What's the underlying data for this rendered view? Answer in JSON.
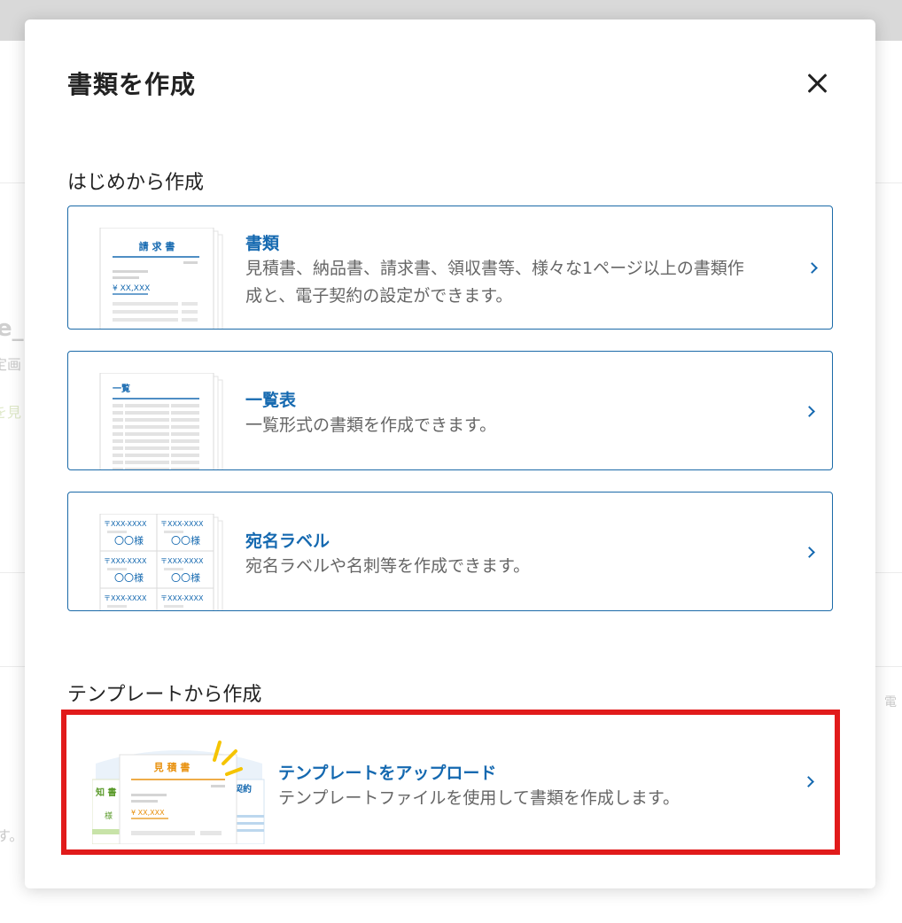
{
  "background": {
    "fragments": [
      "e_",
      "定画",
      "を見",
      "電",
      "す。"
    ]
  },
  "modal": {
    "title": "書類を作成",
    "close_label": "×",
    "section_scratch": "はじめから作成",
    "section_template": "テンプレートから作成"
  },
  "cards": [
    {
      "title": "書類",
      "description_line1": "見積書、納品書、請求書、領収書等、様々な1ページ以上の書類作",
      "description_line2": "成と、電子契約の設定ができます。",
      "thumb": {
        "heading": "請 求 書",
        "amount": "¥ XX,XXX"
      }
    },
    {
      "title": "一覧表",
      "description_line1": "一覧形式の書類を作成できます。",
      "thumb": {
        "heading": "一覧"
      }
    },
    {
      "title": "宛名ラベル",
      "description_line1": "宛名ラベルや名刺等を作成できます。",
      "thumb": {
        "postal": "〒XXX-XXXX",
        "name": "〇〇様"
      }
    },
    {
      "title": "テンプレートをアップロード",
      "description_line1": "テンプレートファイルを使用して書類を作成します。",
      "thumb": {
        "heading": "見 積 書",
        "amount": "¥ XX,XXX",
        "left_side": "知 書",
        "left_sub": "様",
        "right_side": "契約"
      }
    }
  ],
  "colors": {
    "accent": "#1569b0",
    "highlight": "#e11b1b",
    "orange": "#e8900c"
  }
}
